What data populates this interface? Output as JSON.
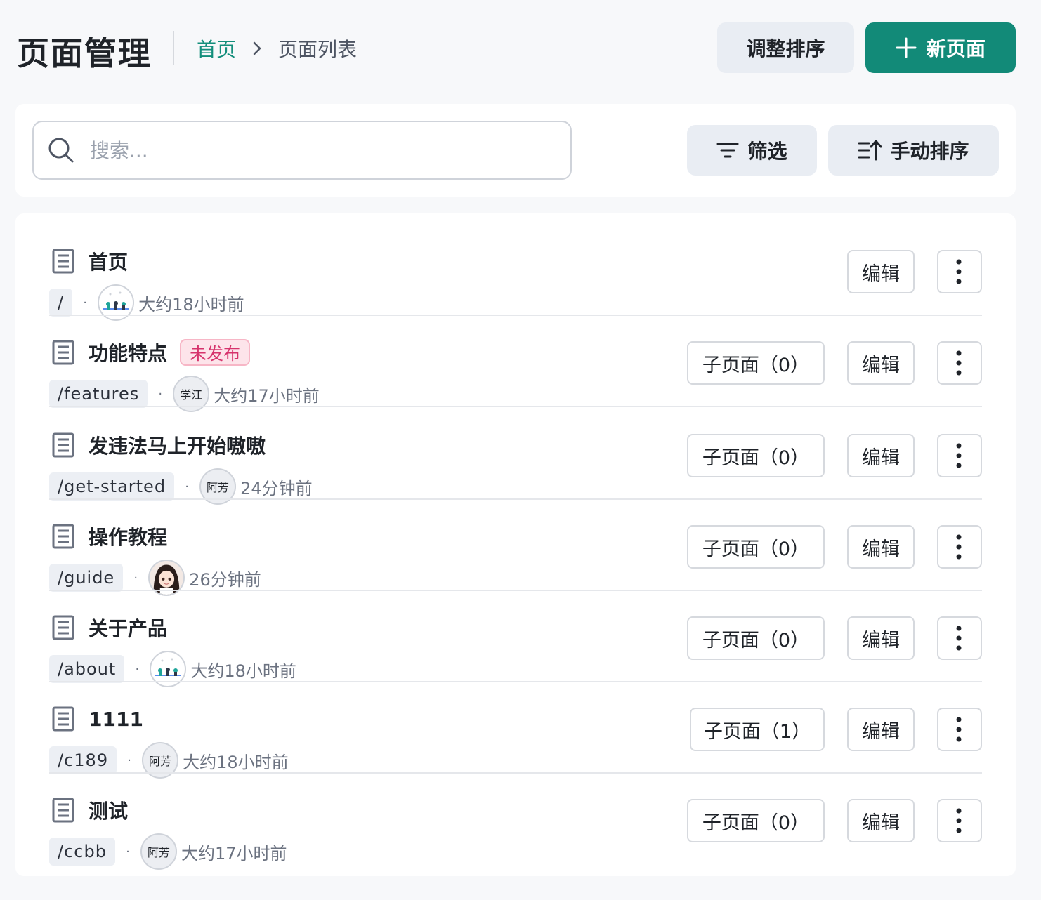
{
  "header": {
    "title": "页面管理",
    "breadcrumb": {
      "home": "首页",
      "current": "页面列表"
    },
    "reorder_label": "调整排序",
    "new_page_label": "新页面"
  },
  "toolbar": {
    "search_placeholder": "搜索...",
    "filter_label": "筛选",
    "sort_label": "手动排序"
  },
  "colors": {
    "accent": "#128a78",
    "breadcrumb_link": "#138e7b",
    "unpublished_badge": "#d6336c"
  },
  "pages": [
    {
      "title": "首页",
      "slug": "/",
      "avatar": "illustration",
      "time": "大约18小时前",
      "subpages": null,
      "edit": "编辑",
      "status": null
    },
    {
      "title": "功能特点",
      "slug": "/features",
      "avatar": "学江",
      "time": "大约17小时前",
      "subpages": "子页面（0）",
      "edit": "编辑",
      "status": "未发布"
    },
    {
      "title": "发违法马上开始嗷嗷",
      "slug": "/get-started",
      "avatar": "阿芳",
      "time": "24分钟前",
      "subpages": "子页面（0）",
      "edit": "编辑",
      "status": null
    },
    {
      "title": "操作教程",
      "slug": "/guide",
      "avatar": "portrait",
      "time": "26分钟前",
      "subpages": "子页面（0）",
      "edit": "编辑",
      "status": null
    },
    {
      "title": "关于产品",
      "slug": "/about",
      "avatar": "illustration",
      "time": "大约18小时前",
      "subpages": "子页面（0）",
      "edit": "编辑",
      "status": null
    },
    {
      "title": "1111",
      "slug": "/c189",
      "avatar": "阿芳",
      "time": "大约18小时前",
      "subpages": "子页面（1）",
      "edit": "编辑",
      "status": null
    },
    {
      "title": "测试",
      "slug": "/ccbb",
      "avatar": "阿芳",
      "time": "大约17小时前",
      "subpages": "子页面（0）",
      "edit": "编辑",
      "status": null
    }
  ]
}
